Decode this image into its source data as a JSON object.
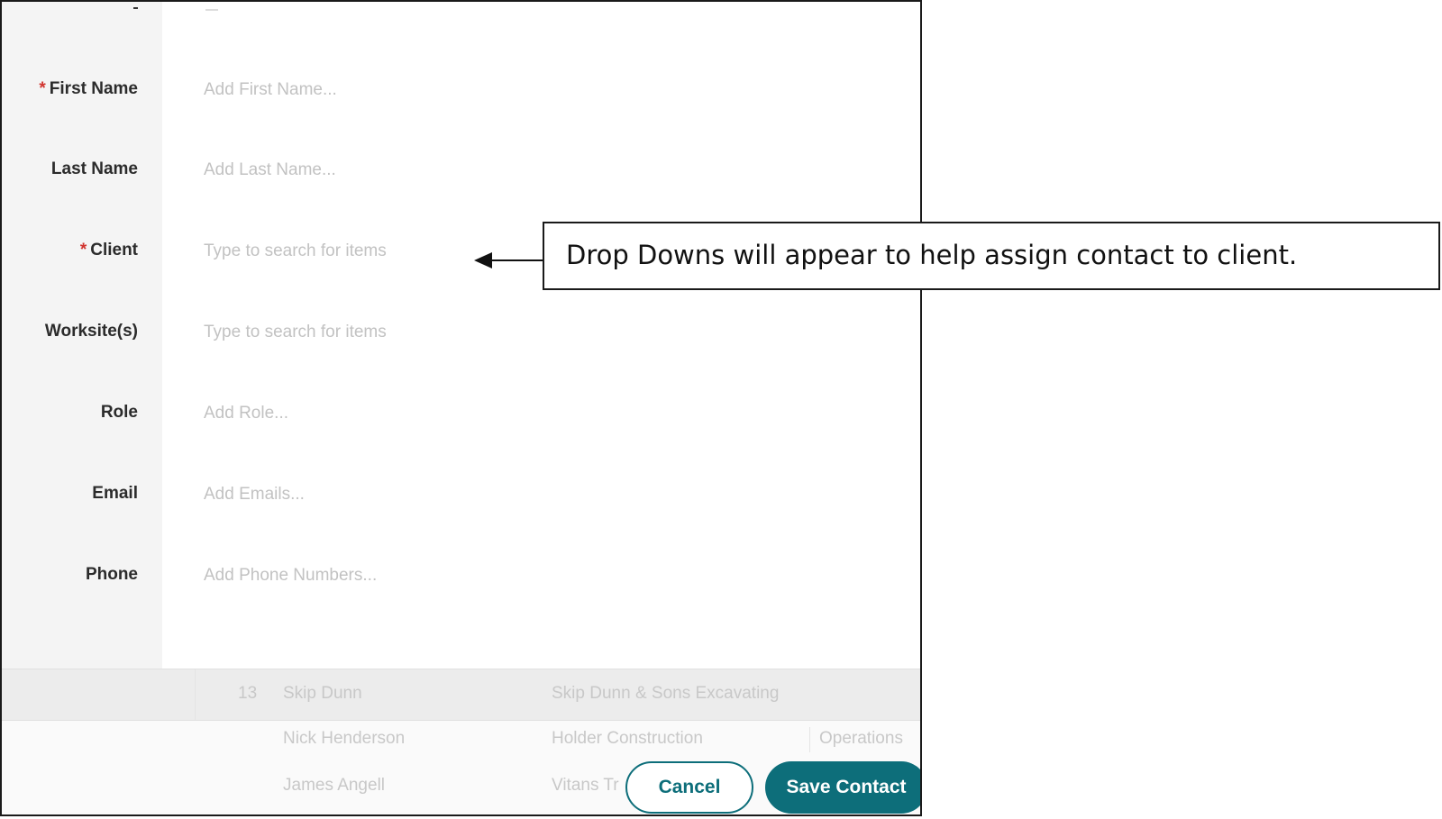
{
  "form": {
    "first_name": {
      "label": "First Name",
      "required_mark": "*",
      "placeholder": "Add First Name..."
    },
    "last_name": {
      "label": "Last Name",
      "placeholder": "Add Last Name..."
    },
    "client": {
      "label": "Client",
      "required_mark": "*",
      "placeholder": "Type to search for items"
    },
    "worksites": {
      "label": "Worksite(s)",
      "placeholder": "Type to search for items"
    },
    "role": {
      "label": "Role",
      "placeholder": "Add Role..."
    },
    "email": {
      "label": "Email",
      "placeholder": "Add Emails..."
    },
    "phone": {
      "label": "Phone",
      "placeholder": "Add Phone Numbers..."
    }
  },
  "background_table": {
    "rows": [
      {
        "id": "13",
        "name": "Skip Dunn",
        "company": "Skip Dunn & Sons Excavating",
        "role": ""
      },
      {
        "id": "",
        "name": "Nick Henderson",
        "company": "Holder Construction",
        "role": "Operations"
      },
      {
        "id": "",
        "name": "James Angell",
        "company": "Vitans Tr",
        "role": ""
      }
    ]
  },
  "buttons": {
    "cancel": "Cancel",
    "save": "Save Contact"
  },
  "annotation": {
    "text": "Drop Downs will appear to help assign contact to client."
  },
  "colors": {
    "accent": "#0d6e7a",
    "required": "#d1342f",
    "label_column_bg": "#f4f4f4",
    "placeholder": "#c2c2c2"
  }
}
